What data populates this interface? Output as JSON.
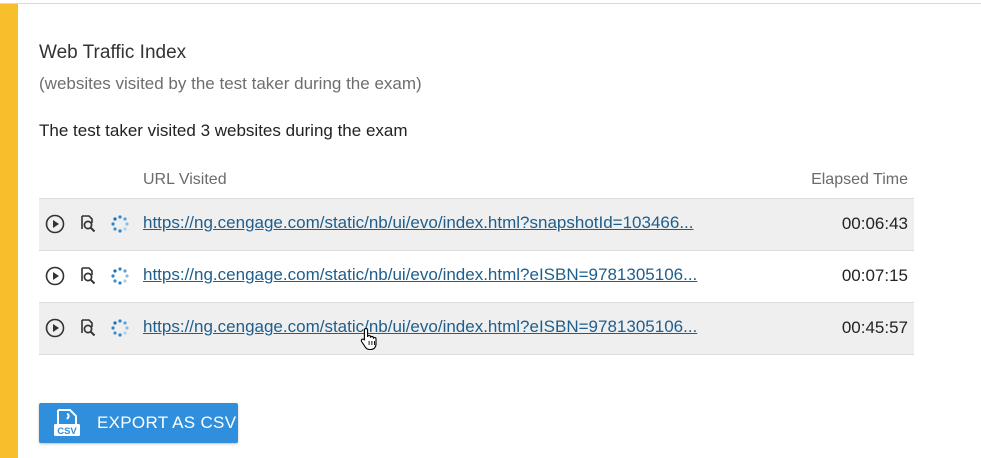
{
  "section": {
    "title": "Web Traffic Index",
    "subtitle": "(websites visited by the test taker during the exam)",
    "summary": "The test taker visited 3 websites during the exam"
  },
  "table": {
    "headers": {
      "url": "URL Visited",
      "elapsed": "Elapsed Time"
    },
    "rows": [
      {
        "url": "https://ng.cengage.com/static/nb/ui/evo/index.html?snapshotId=103466...",
        "elapsed": "00:06:43"
      },
      {
        "url": "https://ng.cengage.com/static/nb/ui/evo/index.html?eISBN=9781305106...",
        "elapsed": "00:07:15"
      },
      {
        "url": "https://ng.cengage.com/static/nb/ui/evo/index.html?eISBN=9781305106...",
        "elapsed": "00:45:57"
      }
    ],
    "row_icons": [
      "play-icon",
      "zoom-icon",
      "loading-spinner-icon"
    ]
  },
  "export": {
    "label": "EXPORT AS CSV",
    "icon": "csv-file-icon"
  },
  "colors": {
    "accent": "#f6bf2b",
    "link": "#1f5e8c",
    "button": "#2f8fdc",
    "row_shade": "#efefef"
  }
}
